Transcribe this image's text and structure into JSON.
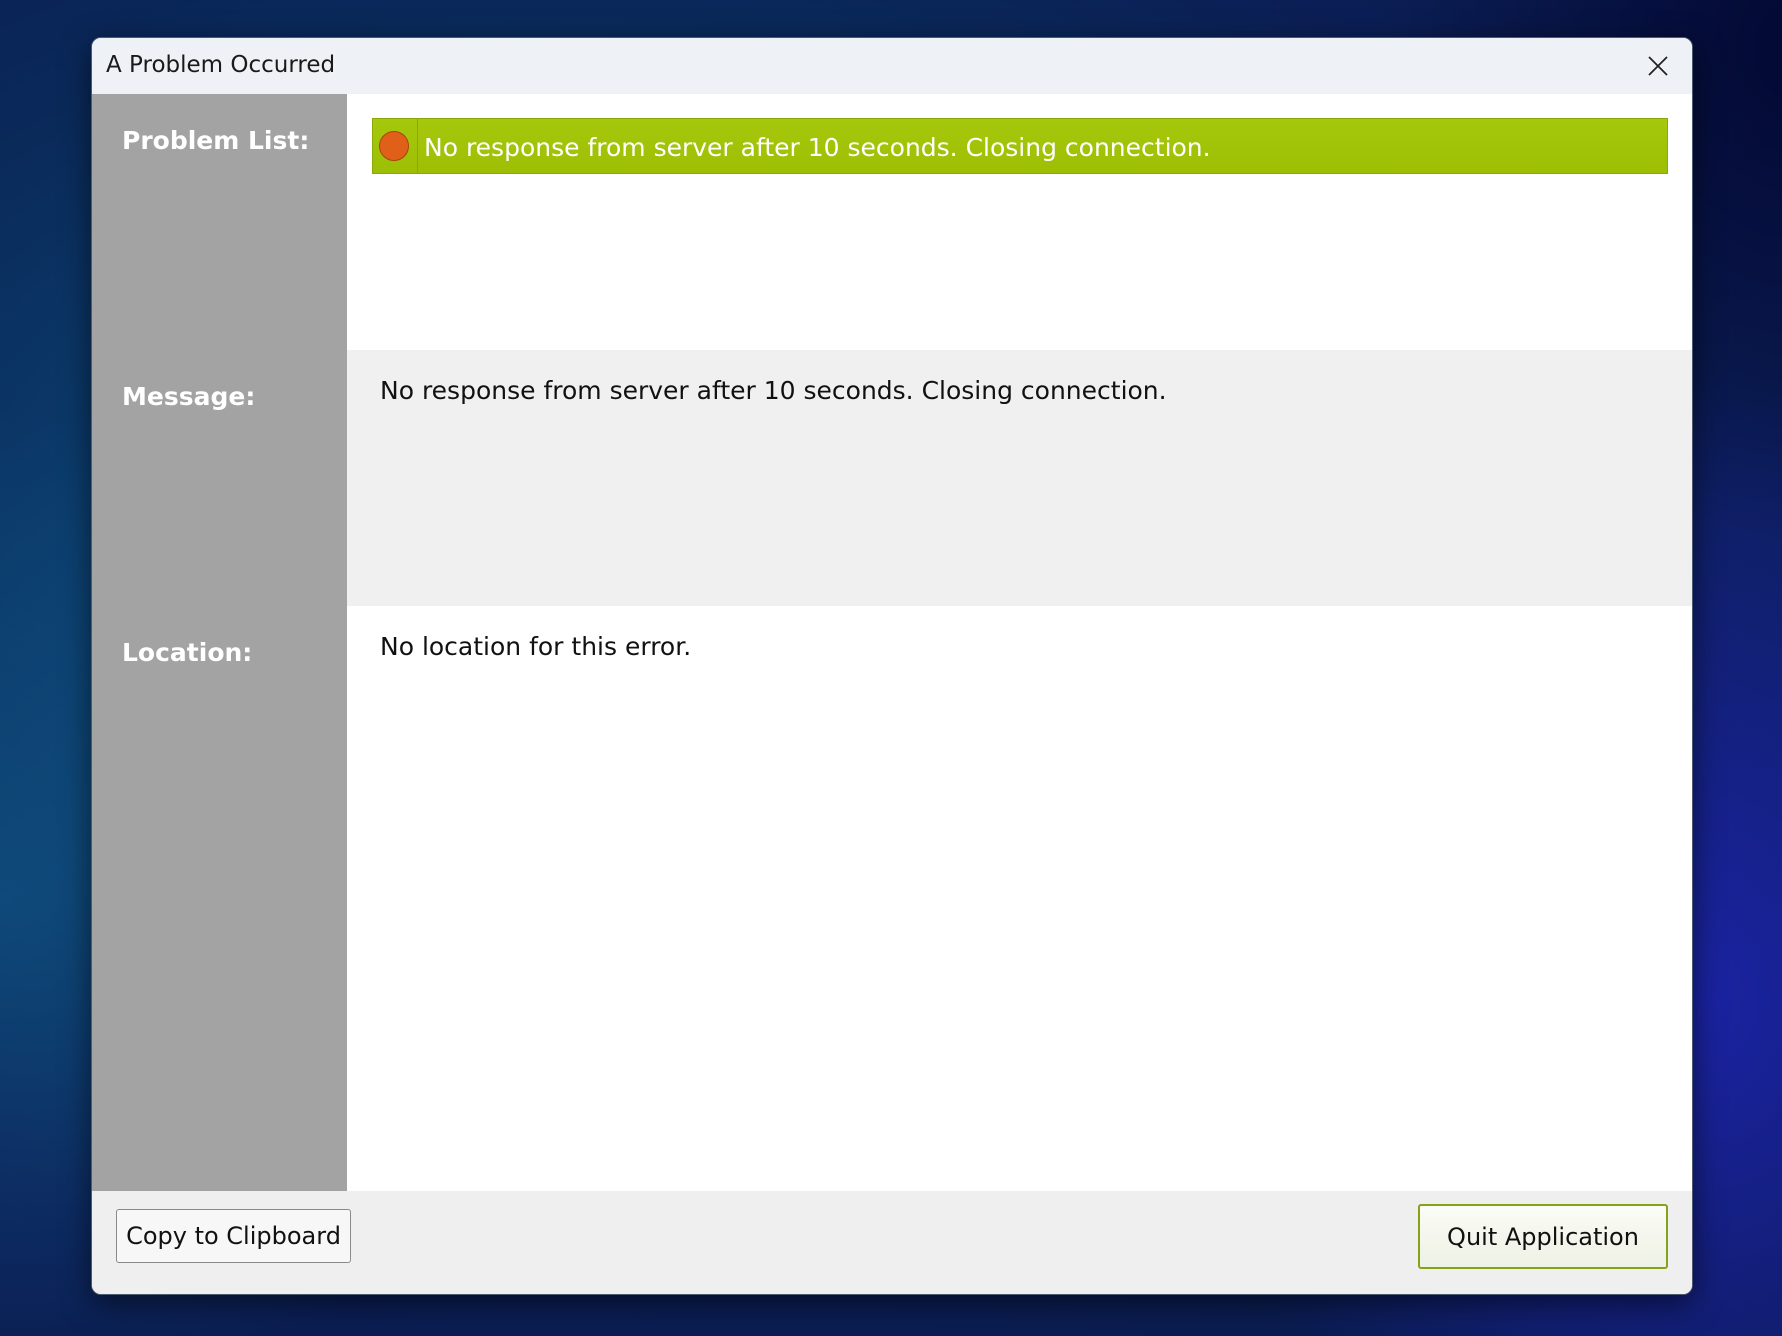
{
  "window": {
    "title": "A Problem Occurred",
    "close_icon": "close-icon"
  },
  "sidebar": {
    "problem_list_label": "Problem List:",
    "message_label": "Message:",
    "location_label": "Location:"
  },
  "problems": [
    {
      "text": "No response from server after 10 seconds. Closing connection.",
      "severity_icon": "error-dot-icon",
      "selected": true
    }
  ],
  "message": {
    "text": "No response from server after 10 seconds. Closing connection."
  },
  "location": {
    "text": "No location for this error."
  },
  "footer": {
    "copy_label": "Copy to Clipboard",
    "quit_label": "Quit Application"
  },
  "colors": {
    "selected_row": "#9cbf04",
    "error_icon": "#e0601a",
    "sidebar": "#a3a3a3",
    "quit_border": "#86a21a"
  }
}
